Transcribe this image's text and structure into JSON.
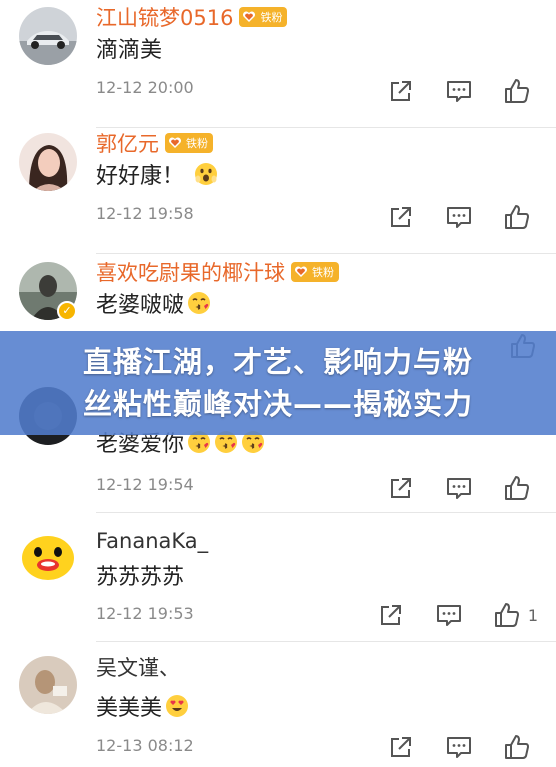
{
  "comments": [
    {
      "name": "江山锍梦0516",
      "fan_badge": "铁粉",
      "text": "滴滴美",
      "emojis": [],
      "time": "12-12 20:00",
      "like_count": "",
      "avatar": "car-photo"
    },
    {
      "name": "郭亿元",
      "fan_badge": "铁粉",
      "text": "好好康！",
      "emojis": [
        "surprised-face"
      ],
      "time": "12-12 19:58",
      "like_count": "",
      "avatar": "woman-photo"
    },
    {
      "name": "喜欢吃尉果的椰汁球",
      "fan_badge": "铁粉",
      "text": "老婆啵啵",
      "emojis": [
        "kiss-face"
      ],
      "time": "",
      "like_count": "",
      "avatar": "man-photo",
      "verified": true
    },
    {
      "name": "",
      "fan_badge": "",
      "text": "老婆爱你",
      "emojis": [
        "kiss-face",
        "kiss-face",
        "kiss-face"
      ],
      "time": "12-12 19:54",
      "like_count": "",
      "avatar": "dark-photo"
    },
    {
      "name": "FananaKa_",
      "fan_badge": "",
      "text": "苏苏苏苏",
      "emojis": [],
      "time": "12-12 19:53",
      "like_count": "1",
      "avatar": "yellow-cartoon"
    },
    {
      "name": "吴文谨、",
      "fan_badge": "",
      "text": "美美美",
      "emojis": [
        "heart-eyes-face"
      ],
      "time": "12-13 08:12",
      "like_count": "",
      "avatar": "person-photo"
    }
  ],
  "overlay": {
    "line1": "直播江湖，才艺、影响力与粉",
    "line2": "丝粘性巅峰对决——揭秘实力"
  },
  "colors": {
    "name_orange": "#e8682a",
    "fan_badge": "#f5b22a",
    "overlay_bg": "#527dcd"
  },
  "icons": [
    "share-icon",
    "comment-icon",
    "like-icon"
  ]
}
